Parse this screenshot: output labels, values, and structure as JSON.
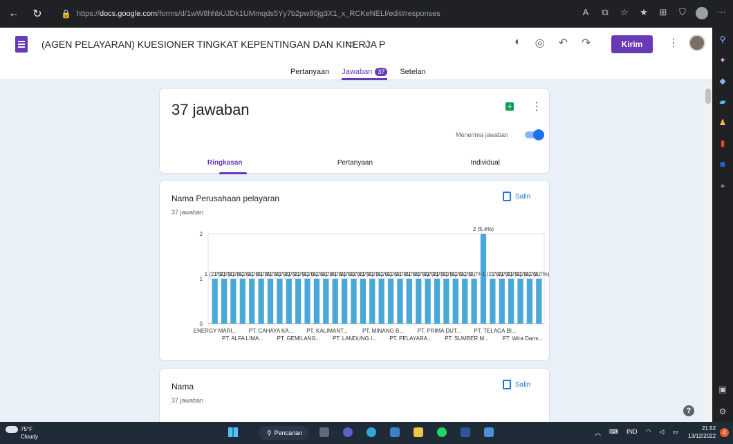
{
  "browser": {
    "url_prefix": "https://",
    "url_domain": "docs.google.com",
    "url_path": "/forms/d/1wW8hhbUJDk1UMmqds5Yy7b2pw80jg3X1_x_RCKeNELI/edit#responses"
  },
  "header": {
    "form_title": "(AGEN PELAYARAN) KUESIONER TINGKAT KEPENTINGAN DAN KINERJA P",
    "send_label": "Kirim",
    "tabs": [
      {
        "label": "Pertanyaan"
      },
      {
        "label": "Jawaban",
        "badge": "37"
      },
      {
        "label": "Setelan"
      }
    ]
  },
  "summary": {
    "count_title": "37 jawaban",
    "accepting_label": "Menerima jawaban",
    "accepting_responses": true,
    "sub_tabs": [
      {
        "label": "Ringkasan"
      },
      {
        "label": "Pertanyaan"
      },
      {
        "label": "Individual"
      }
    ]
  },
  "question1": {
    "title": "Nama Perusahaan pelayaran",
    "count": "37 jawaban",
    "copy_label": "Salin"
  },
  "question2": {
    "title": "Nama",
    "count": "37 jawaban",
    "copy_label": "Salin"
  },
  "taskbar": {
    "temp": "75°F",
    "condition": "Cloudy",
    "search_label": "Pencarian",
    "lang": "IND",
    "time": "21.52",
    "date": "13/12/2022",
    "notifications": "4"
  },
  "colors": {
    "accent": "#673ab7",
    "bar": "#4aa8d8",
    "background": "#e9f0f8"
  },
  "chart_data": {
    "type": "bar",
    "ylim": [
      0,
      2
    ],
    "yticks": [
      "0",
      "1",
      "2"
    ],
    "categories_top": [
      "ENERGY MARI...",
      "PT. CAHAYA KA...",
      "PT. KALIMANT...",
      "PT. MINANG B...",
      "PT. PRIMA DUT...",
      "PT. TELAGA BI..."
    ],
    "categories_bottom": [
      "PT. ALFA LIMA...",
      "PT. GEMILANG...",
      "PT. LANDUNG I...",
      "PT. PELAYARA...",
      "PT. SUMBER M...",
      "PT. Wira Darm..."
    ],
    "values": [
      1,
      1,
      1,
      1,
      1,
      1,
      1,
      1,
      1,
      1,
      1,
      1,
      1,
      1,
      1,
      1,
      1,
      1,
      1,
      1,
      1,
      1,
      1,
      1,
      1,
      1,
      1,
      1,
      1,
      2,
      1,
      1,
      1,
      1,
      1,
      1
    ],
    "value_label_single": "1 (2,7%)",
    "value_label_peak": "2 (5,4%)",
    "peak_index": 29
  }
}
